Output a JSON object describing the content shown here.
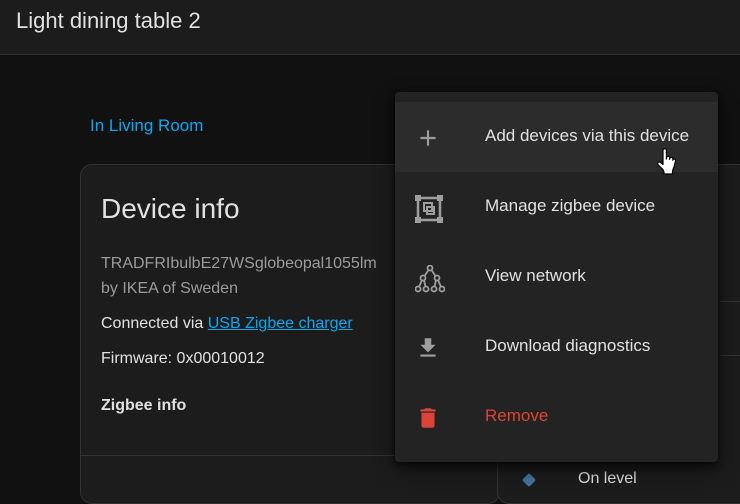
{
  "header": {
    "title": "Light dining table 2"
  },
  "area_link": "In Living Room",
  "device_info": {
    "title": "Device info",
    "model": "TRADFRIbulbE27WSglobeopal1055lm",
    "manufacturer": "by IKEA of Sweden",
    "connected_via_label": "Connected via",
    "connected_via_link": "USB Zigbee charger",
    "firmware": "Firmware: 0x00010012",
    "zigbee_info": "Zigbee info"
  },
  "right_card": {
    "entity_label": "On level"
  },
  "menu": {
    "items": [
      {
        "label": "Add devices via this device",
        "icon": "plus-icon"
      },
      {
        "label": "Manage zigbee device",
        "icon": "zigbee-manage-icon"
      },
      {
        "label": "View network",
        "icon": "network-icon"
      },
      {
        "label": "Download diagnostics",
        "icon": "download-icon"
      },
      {
        "label": "Remove",
        "icon": "trash-icon"
      }
    ]
  },
  "colors": {
    "accent": "#03a9f4",
    "danger": "#db4437",
    "menu_bg": "#232323",
    "page_bg": "#111111"
  }
}
